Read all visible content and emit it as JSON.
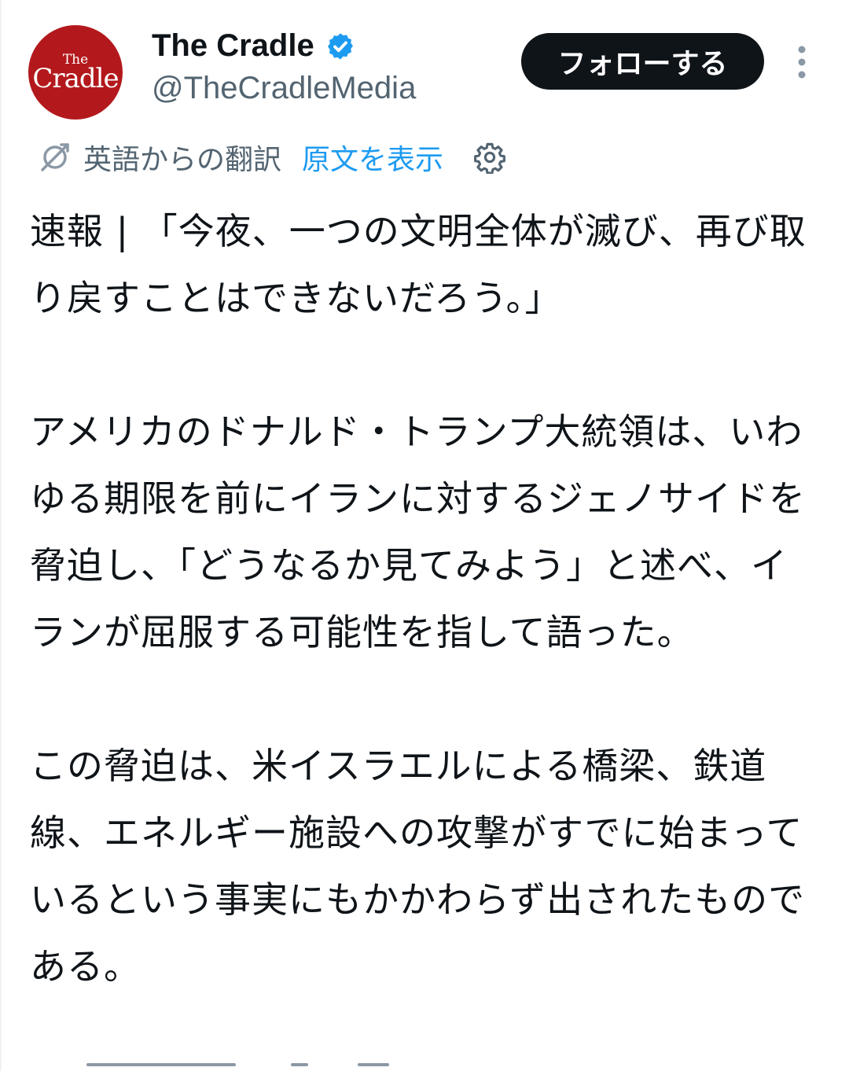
{
  "author": {
    "display_name": "The Cradle",
    "handle": "@TheCradleMedia",
    "avatar_text_top": "The",
    "avatar_text_bottom": "Cradle",
    "verified": true,
    "avatar_color": "#b3191c",
    "verified_color": "#1d9bf0"
  },
  "actions": {
    "follow_label": "フォローする",
    "more_icon": "more-vertical-icon"
  },
  "translation": {
    "label": "英語からの翻訳",
    "show_original": "原文を表示",
    "translate_icon": "translate-icon",
    "settings_icon": "gear-icon"
  },
  "post": {
    "paragraphs": [
      "速報 | 「今夜、一つの文明全体が滅び、再び取り戻すことはできないだろう。」",
      "アメリカのドナルド・トランプ大統領は、いわゆる期限を前にイランに対するジェノサイドを脅迫し、「どうなるか見てみよう」と述べ、イランが屈服する可能性を指して語った。",
      "この脅迫は、米イスラエルによる橋梁、鉄道線、エネルギー施設への攻撃がすでに始まっているという事実にもかかわらず出されたものである。"
    ]
  }
}
